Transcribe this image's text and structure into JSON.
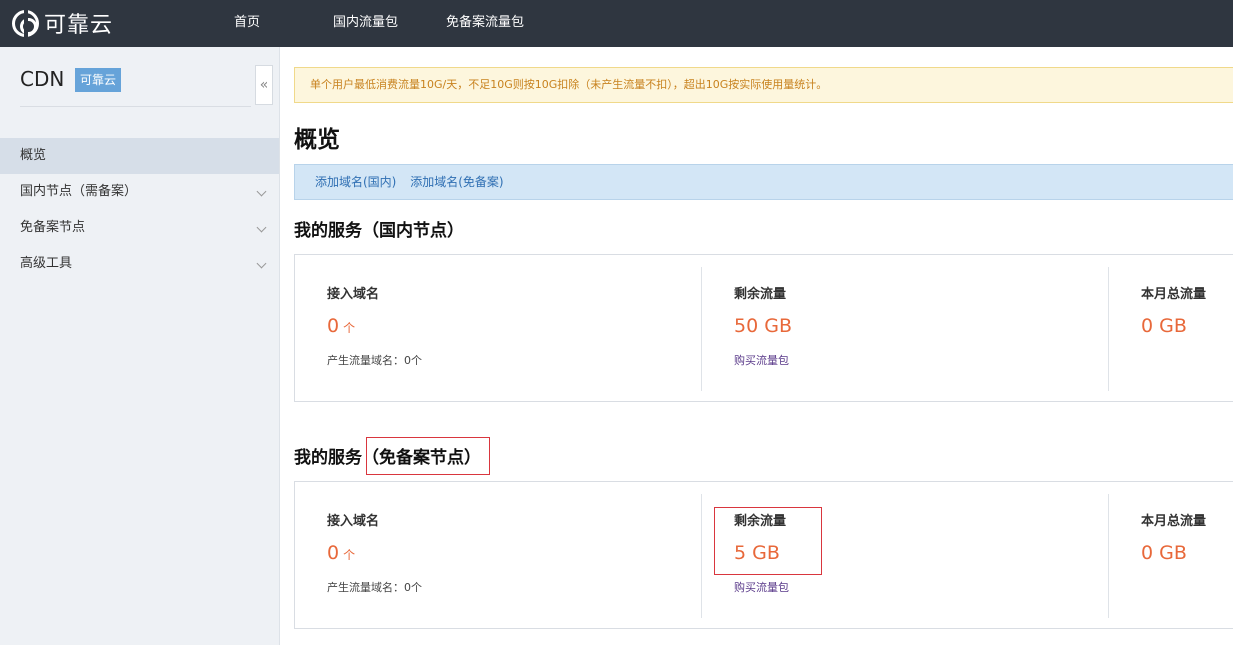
{
  "topbar": {
    "logo_text": "可靠云",
    "nav": [
      "首页",
      "国内流量包",
      "免备案流量包"
    ]
  },
  "sidebar": {
    "title": "CDN",
    "badge": "可靠云",
    "collapse_icon": "«",
    "items": [
      {
        "label": "概览",
        "active": true
      },
      {
        "label": "国内节点（需备案）"
      },
      {
        "label": "免备案节点"
      },
      {
        "label": "高级工具"
      }
    ]
  },
  "main": {
    "notice": "单个用户最低消费流量10G/天，不足10G则按10G扣除（未产生流量不扣），超出10G按实际使用量统计。",
    "page_title": "概览",
    "actions": [
      "添加域名(国内)",
      "添加域名(免备案)"
    ],
    "sections": [
      {
        "title_prefix": "我的服务",
        "title_suffix": "（国内节点）",
        "domains_label": "接入域名",
        "domains_value": "0",
        "domains_unit": "个",
        "domains_sub": "产生流量域名：0个",
        "remaining_label": "剩余流量",
        "remaining_value": "50 GB",
        "remaining_link": "购买流量包",
        "monthly_label": "本月总流量",
        "monthly_value": "0 GB"
      },
      {
        "title_prefix": "我的服务",
        "title_suffix": "（免备案节点）",
        "domains_label": "接入域名",
        "domains_value": "0",
        "domains_unit": "个",
        "domains_sub": "产生流量域名：0个",
        "remaining_label": "剩余流量",
        "remaining_value": "5 GB",
        "remaining_link": "购买流量包",
        "monthly_label": "本月总流量",
        "monthly_value": "0 GB"
      }
    ]
  },
  "colors": {
    "topbar": "#2f3640",
    "accent_value": "#e8683a",
    "highlight": "#d9363e"
  }
}
